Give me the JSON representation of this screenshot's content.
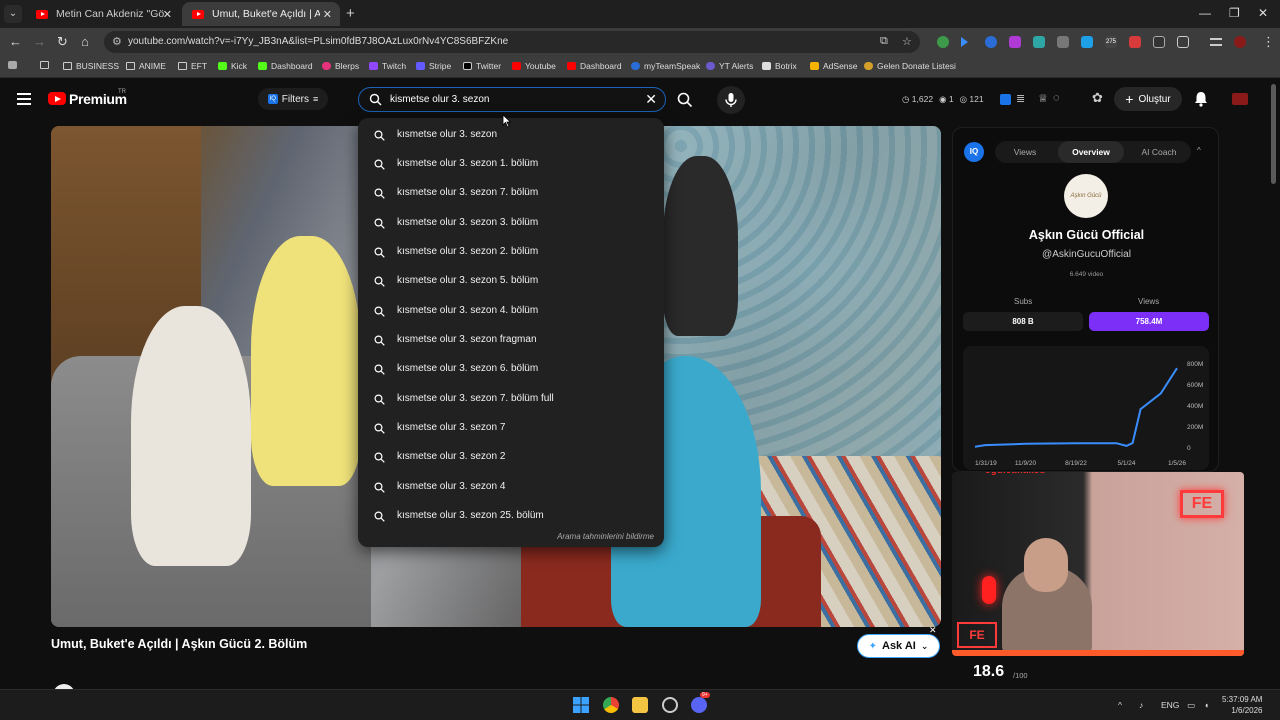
{
  "browser": {
    "tabs": [
      {
        "title": "Metin Can Akdeniz \"Gönül İşin",
        "active": false
      },
      {
        "title": "Umut, Buket'e Açıldı | Aşkın Gü",
        "active": true
      }
    ],
    "url": "youtube.com/watch?v=-i7Yy_JB3nA&list=PLsim0fdB7J8OAzLux0rNv4YC8S6BFZKne",
    "bookmarks": [
      "BUSINESS",
      "ANIME",
      "EFT",
      "Kick",
      "Dashboard",
      "Blerps",
      "Twitch",
      "Stripe",
      "Twitter",
      "Youtube",
      "Dashboard",
      "myTeamSpeak",
      "YT Alerts",
      "Botrix",
      "AdSense",
      "Gelen Donate Listesi"
    ],
    "extension_badge": "275"
  },
  "header": {
    "logo_text": "Premium",
    "logo_region": "TR",
    "filters_label": "Filters",
    "iq_label": "IQ",
    "search_value": "kismetse olur 3. sezon",
    "stats": [
      "1,622",
      "1",
      "121"
    ],
    "create_label": "Oluştur"
  },
  "suggestions": {
    "items": [
      "kısmetse olur 3. sezon",
      "kısmetse olur 3. sezon 1. bölüm",
      "kısmetse olur 3. sezon 7. bölüm",
      "kısmetse olur 3. sezon 3. bölüm",
      "kısmetse olur 3. sezon 2. bölüm",
      "kısmetse olur 3. sezon 5. bölüm",
      "kısmetse olur 3. sezon 4. bölüm",
      "kısmetse olur 3. sezon fragman",
      "kısmetse olur 3. sezon 6. bölüm",
      "kısmetse olur 3. sezon 7. bölüm full",
      "kısmetse olur 3. sezon 7",
      "kısmetse olur 3. sezon 2",
      "kısmetse olur 3. sezon 4",
      "kısmetse olur 3. sezon 25. bölüm"
    ],
    "footer": "Arama tahminlerini bildirme"
  },
  "video": {
    "title": "Umut, Buket'e Açıldı | Aşkın Gücü 2. Bölüm",
    "ask_ai_label": "Ask AI"
  },
  "panel": {
    "badge": "IQ",
    "tabs": [
      "Views",
      "Overview",
      "AI Coach"
    ],
    "active_tab": "Overview",
    "avatar_text": "Aşkın Gücü",
    "channel_name": "Aşkın Gücü Official",
    "handle": "@AskinGucuOfficial",
    "video_count": "6.649 video",
    "subs_label": "Subs",
    "subs_value": "808 B",
    "views_label": "Views",
    "views_value": "758.4M",
    "score": "18.6",
    "score_max": "/100"
  },
  "chart_data": {
    "type": "line",
    "x": [
      "1/31/19",
      "11/9/20",
      "8/19/22",
      "5/1/24",
      "1/5/26"
    ],
    "y_ticks": [
      "800M",
      "600M",
      "400M",
      "200M",
      "0"
    ],
    "ylim": [
      0,
      800
    ],
    "series": [
      {
        "points": [
          [
            0,
            12
          ],
          [
            0.05,
            28
          ],
          [
            0.25,
            40
          ],
          [
            0.5,
            45
          ],
          [
            0.7,
            46
          ],
          [
            0.75,
            20
          ],
          [
            0.78,
            48
          ],
          [
            0.82,
            370
          ],
          [
            0.92,
            520
          ],
          [
            1.0,
            760
          ]
        ]
      }
    ],
    "line_color": "#3a8dff"
  },
  "webcam": {
    "overlay_name": "ogulcanaksu"
  },
  "taskbar": {
    "lang": "ENG",
    "time": "5:37:09 AM",
    "date": "1/6/2026",
    "discord_badge": "9+"
  }
}
